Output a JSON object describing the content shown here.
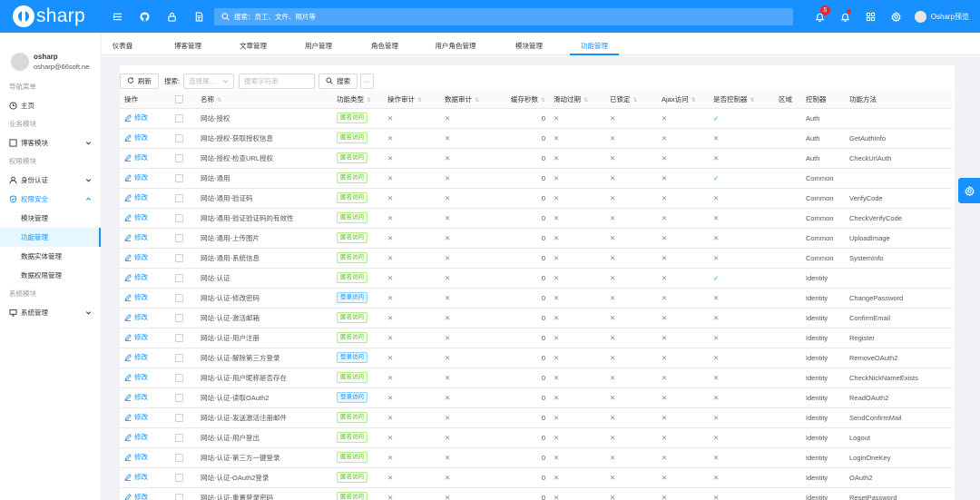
{
  "header": {
    "logo_text": "sharp",
    "search_placeholder": "搜索：员工、文件、照片等",
    "notification_count": "5",
    "user_name": "Osharp预览"
  },
  "sidebar": {
    "user_name": "osharp",
    "user_email": "osharp@66soft.ne",
    "nav_group": "导航菜单",
    "home": "主页",
    "biz_group": "业务模块",
    "blog": "博客模块",
    "perm_group": "权限模块",
    "identity": "身份认证",
    "security": "权限安全",
    "sub_module": "模块管理",
    "sub_function": "功能管理",
    "sub_entity": "数据实体管理",
    "sub_dataperm": "数据权限管理",
    "sys_group": "系统模块",
    "system": "系统管理"
  },
  "tabs": [
    "仪表盘",
    "博客管理",
    "文章管理",
    "用户管理",
    "角色管理",
    "用户角色管理",
    "模块管理",
    "功能管理"
  ],
  "toolbar": {
    "refresh": "刷新",
    "search_label": "搜索:",
    "select_placeholder": "选择属...",
    "keyword_placeholder": "搜索字符串",
    "search_button": "搜索",
    "more": "···"
  },
  "columns": [
    "操作",
    "名称",
    "功能类型",
    "操作审计",
    "数据审计",
    "缓存秒数",
    "滑动过期",
    "已锁定",
    "Ajax访问",
    "是否控制器",
    "区域",
    "控制器",
    "功能方法"
  ],
  "edit_label": "修改",
  "rows": [
    {
      "name": "网站-授权",
      "type": "匿名访问",
      "type_kind": "anon",
      "cache": "0",
      "is_ctrl": true,
      "controller": "Auth",
      "action": ""
    },
    {
      "name": "网站-授权-获取授权信息",
      "type": "匿名访问",
      "type_kind": "anon",
      "cache": "0",
      "is_ctrl": false,
      "controller": "Auth",
      "action": "GetAuthInfo"
    },
    {
      "name": "网站-授权-检查URL授权",
      "type": "匿名访问",
      "type_kind": "anon",
      "cache": "0",
      "is_ctrl": false,
      "controller": "Auth",
      "action": "CheckUrlAuth"
    },
    {
      "name": "网站-通用",
      "type": "匿名访问",
      "type_kind": "anon",
      "cache": "0",
      "is_ctrl": true,
      "controller": "Common",
      "action": ""
    },
    {
      "name": "网站-通用-验证码",
      "type": "匿名访问",
      "type_kind": "anon",
      "cache": "0",
      "is_ctrl": false,
      "controller": "Common",
      "action": "VerifyCode"
    },
    {
      "name": "网站-通用-验证验证码的有效性",
      "type": "匿名访问",
      "type_kind": "anon",
      "cache": "0",
      "is_ctrl": false,
      "controller": "Common",
      "action": "CheckVerifyCode"
    },
    {
      "name": "网站-通用-上传图片",
      "type": "匿名访问",
      "type_kind": "anon",
      "cache": "0",
      "is_ctrl": false,
      "controller": "Common",
      "action": "UploadImage"
    },
    {
      "name": "网站-通用-系统信息",
      "type": "匿名访问",
      "type_kind": "anon",
      "cache": "0",
      "is_ctrl": false,
      "controller": "Common",
      "action": "SystemInfo"
    },
    {
      "name": "网站-认证",
      "type": "匿名访问",
      "type_kind": "anon",
      "cache": "0",
      "is_ctrl": true,
      "controller": "Identity",
      "action": ""
    },
    {
      "name": "网站-认证-修改密码",
      "type": "登录访问",
      "type_kind": "login",
      "cache": "0",
      "is_ctrl": false,
      "controller": "Identity",
      "action": "ChangePassword"
    },
    {
      "name": "网站-认证-激活邮箱",
      "type": "匿名访问",
      "type_kind": "anon",
      "cache": "0",
      "is_ctrl": false,
      "controller": "Identity",
      "action": "ConfirmEmail"
    },
    {
      "name": "网站-认证-用户注册",
      "type": "匿名访问",
      "type_kind": "anon",
      "cache": "0",
      "is_ctrl": false,
      "controller": "Identity",
      "action": "Register"
    },
    {
      "name": "网站-认证-解除第三方登录",
      "type": "登录访问",
      "type_kind": "login",
      "cache": "0",
      "is_ctrl": false,
      "controller": "Identity",
      "action": "RemoveOAuth2"
    },
    {
      "name": "网站-认证-用户昵称是否存在",
      "type": "匿名访问",
      "type_kind": "anon",
      "cache": "0",
      "is_ctrl": false,
      "controller": "Identity",
      "action": "CheckNickNameExists"
    },
    {
      "name": "网站-认证-读取OAuth2",
      "type": "登录访问",
      "type_kind": "login",
      "cache": "0",
      "is_ctrl": false,
      "controller": "Identity",
      "action": "ReadOAuth2"
    },
    {
      "name": "网站-认证-发送激活注册邮件",
      "type": "匿名访问",
      "type_kind": "anon",
      "cache": "0",
      "is_ctrl": false,
      "controller": "Identity",
      "action": "SendConfirmMail"
    },
    {
      "name": "网站-认证-用户登出",
      "type": "匿名访问",
      "type_kind": "anon",
      "cache": "0",
      "is_ctrl": false,
      "controller": "Identity",
      "action": "Logout"
    },
    {
      "name": "网站-认证-第三方一键登录",
      "type": "匿名访问",
      "type_kind": "anon",
      "cache": "0",
      "is_ctrl": false,
      "controller": "Identity",
      "action": "LoginOneKey"
    },
    {
      "name": "网站-认证-OAuth2登录",
      "type": "匿名访问",
      "type_kind": "anon",
      "cache": "0",
      "is_ctrl": false,
      "controller": "Identity",
      "action": "OAuth2"
    },
    {
      "name": "网站-认证-重置登录密码",
      "type": "匿名访问",
      "type_kind": "anon",
      "cache": "0",
      "is_ctrl": false,
      "controller": "Identity",
      "action": "ResetPassword"
    }
  ],
  "colors": {
    "primary": "#1890ff",
    "anon_tag": "#52c41a",
    "login_tag": "#1890ff"
  },
  "icons": {
    "menu": "menu-icon",
    "github": "github-icon",
    "lock": "lock-icon",
    "doc": "document-icon",
    "search": "search-icon",
    "bell": "bell-icon",
    "grid": "apps-icon",
    "gear": "gear-icon"
  }
}
